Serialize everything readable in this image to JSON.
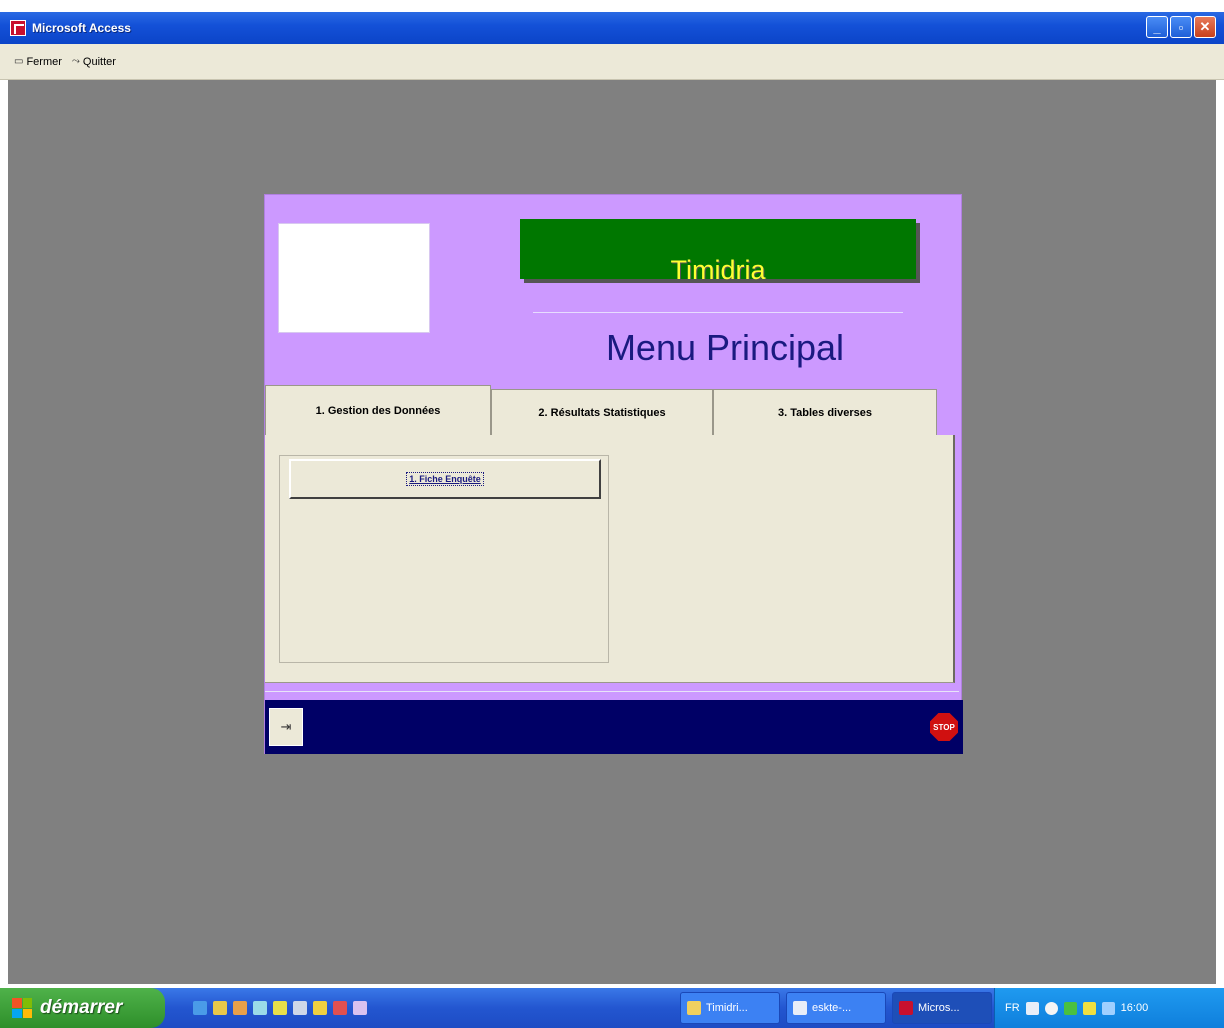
{
  "window": {
    "title": "Microsoft Access",
    "buttons": [
      "minimize",
      "maximize",
      "close"
    ]
  },
  "menubar": {
    "items": [
      {
        "label": "Fermer",
        "icon": "close-form-icon"
      },
      {
        "label": "Quitter",
        "icon": "exit-icon"
      }
    ]
  },
  "form": {
    "brand_title": "Timidria",
    "heading": "Menu Principal",
    "tabs": [
      {
        "label": "1. Gestion des Données",
        "active": true
      },
      {
        "label": "2. Résultats Statistiques",
        "active": false
      },
      {
        "label": "3. Tables diverses",
        "active": false
      }
    ],
    "buttons": {
      "fiche_enquete": "1. Fiche Enquête"
    },
    "footer": {
      "stop_label": "STOP"
    },
    "colors": {
      "form_background": "#cc99ff",
      "banner": "#007700",
      "brand_text": "#ffff33",
      "heading_text": "#1a1a80",
      "footer": "#000066"
    }
  },
  "taskbar": {
    "start_label": "démarrer",
    "tasks": [
      {
        "label": "Timidri...",
        "icon": "folder-icon"
      },
      {
        "label": "eskte-...",
        "icon": "document-icon"
      },
      {
        "label": "Micros...",
        "icon": "access-icon",
        "active": true
      }
    ],
    "tray": {
      "language": "FR",
      "clock": "16:00"
    }
  }
}
